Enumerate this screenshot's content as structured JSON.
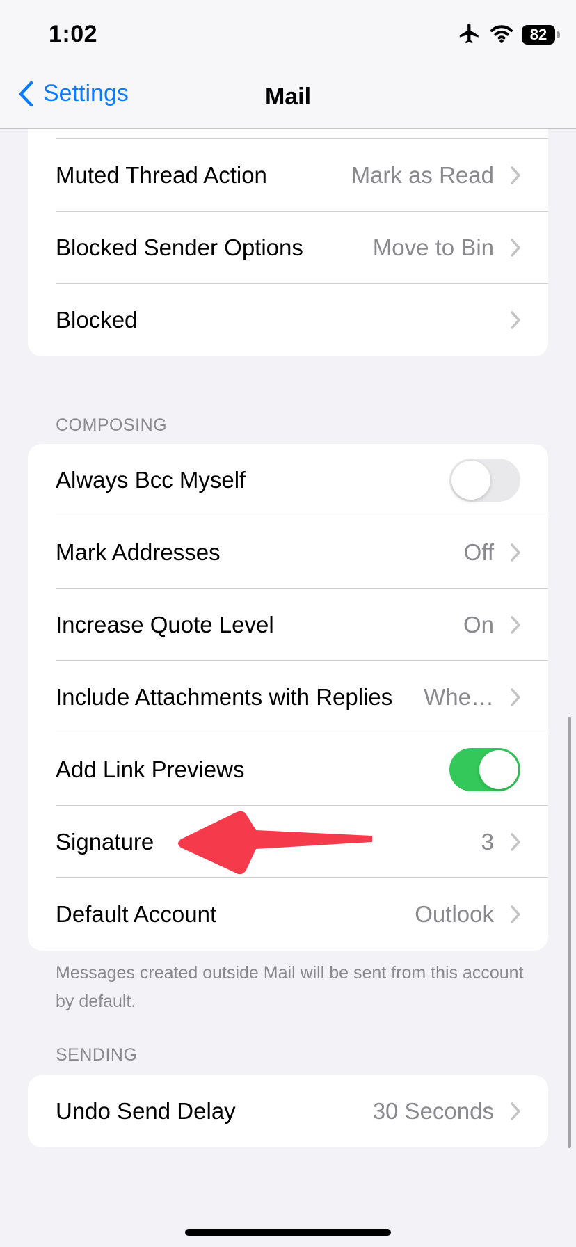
{
  "status_bar": {
    "time": "1:02",
    "battery": "82"
  },
  "nav": {
    "back_label": "Settings",
    "title": "Mail"
  },
  "threading_group": {
    "rows": [
      {
        "label": "Muted Thread Action",
        "value": "Mark as Read"
      },
      {
        "label": "Blocked Sender Options",
        "value": "Move to Bin"
      },
      {
        "label": "Blocked",
        "value": ""
      }
    ]
  },
  "composing": {
    "header": "COMPOSING",
    "always_bcc": {
      "label": "Always Bcc Myself",
      "on": false
    },
    "mark_addresses": {
      "label": "Mark Addresses",
      "value": "Off"
    },
    "increase_quote": {
      "label": "Increase Quote Level",
      "value": "On"
    },
    "include_attachments": {
      "label": "Include Attachments with Replies",
      "value": "Whe…"
    },
    "link_previews": {
      "label": "Add Link Previews",
      "on": true
    },
    "signature": {
      "label": "Signature",
      "value": "3"
    },
    "default_account": {
      "label": "Default Account",
      "value": "Outlook"
    },
    "footer": "Messages created outside Mail will be sent from this account by default."
  },
  "sending": {
    "header": "SENDING",
    "undo_send": {
      "label": "Undo Send Delay",
      "value": "30 Seconds"
    }
  },
  "colors": {
    "accent": "#0a7bff",
    "toggle_on": "#34c759",
    "annotation_arrow": "#f53a4c"
  }
}
